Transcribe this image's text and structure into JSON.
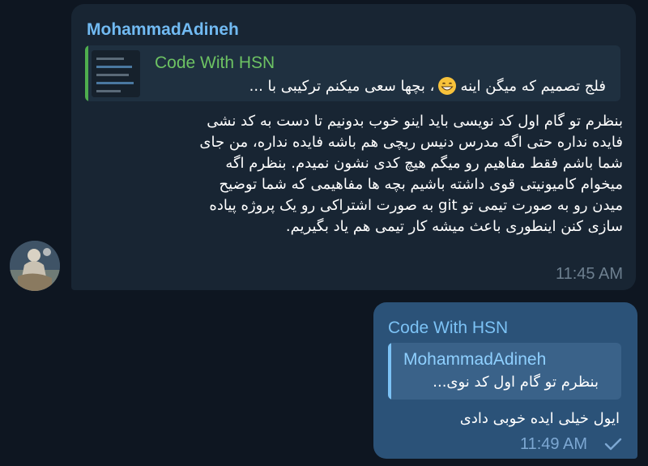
{
  "incoming": {
    "sender": "MohammadAdineh",
    "reply": {
      "title": "Code With HSN",
      "quote_before_emoji": "فلج تصمیم که میگن اینه",
      "emoji_name": "grinning-face-icon",
      "quote_after_emoji": "، بچها سعی میکنم ترکیبی با ..."
    },
    "body_lines": [
      "بنظرم تو گام اول کد نویسی باید اینو خوب بدونیم تا دست به کد نشی",
      "فایده نداره حتی اگه مدرس دنیس ریچی هم باشه فایده نداره، من جای",
      "شما باشم فقط مفاهیم رو میگم هیچ کدی نشون نمیدم. بنظرم اگه",
      "میخوام کامیونیتی قوی داشته باشیم بچه ها مفاهیمی که شما توضیح",
      "میدن رو به صورت تیمی تو git به صورت اشتراکی رو یک پروژه پیاده",
      "سازی کنن اینطوری باعث میشه کار تیمی هم یاد بگیریم."
    ],
    "time": "11:45 AM"
  },
  "outgoing": {
    "sender": "Code With HSN",
    "reply": {
      "title": "MohammadAdineh",
      "quote": "بنظرم تو گام اول کد نوی..."
    },
    "body": "ایول خیلی ایده خوبی دادی",
    "time": "11:49 AM",
    "status_icon": "check-icon"
  },
  "colors": {
    "background": "#0e1621",
    "incoming_bubble": "#182533",
    "outgoing_bubble": "#2b5278",
    "sender_blue": "#71baf2",
    "reply_green": "#6dc263"
  }
}
